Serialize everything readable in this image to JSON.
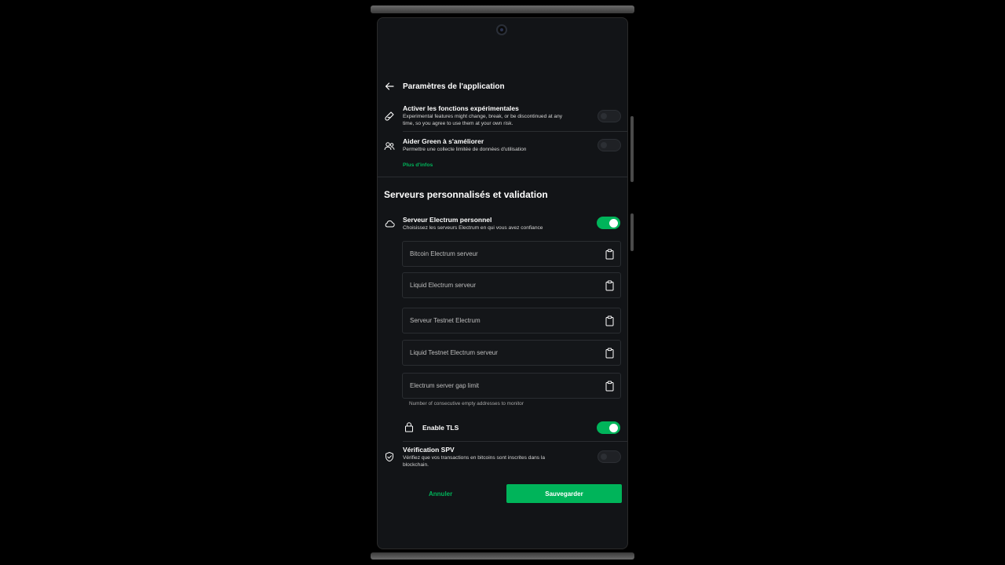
{
  "header": {
    "title": "Paramètres de l'application"
  },
  "experimental": {
    "title": "Activer les fonctions expérimentales",
    "desc_line1": "Experimental features might change, break, or be discontinued at any",
    "desc_line2": "time, so you agree to use them at your own risk.",
    "enabled": false
  },
  "analytics": {
    "title": "Aider Green à s'améliorer",
    "desc": "Permettre une collecte limitée de données d'utilisation",
    "link": "Plus d'infos",
    "enabled": false
  },
  "section_title": "Serveurs personnalisés et validation",
  "electrum": {
    "title": "Serveur Electrum personnel",
    "desc": "Choisissez les serveurs Electrum en qui vous avez confiance",
    "enabled": true,
    "fields": [
      {
        "placeholder": "Bitcoin Electrum serveur"
      },
      {
        "placeholder": "Liquid Electrum serveur"
      },
      {
        "placeholder": "Serveur Testnet Electrum"
      },
      {
        "placeholder": "Liquid Testnet Electrum serveur"
      },
      {
        "placeholder": "Electrum server gap limit"
      }
    ],
    "gap_hint": "Number of consecutive empty addresses to monitor"
  },
  "tls": {
    "label": "Enable TLS",
    "enabled": true
  },
  "spv": {
    "title": "Vérification SPV",
    "desc_line1": "Vérifiez que vos transactions en bitcoins sont inscrites dans la",
    "desc_line2": "blockchain.",
    "enabled": false
  },
  "actions": {
    "cancel": "Annuler",
    "save": "Sauvegarder"
  },
  "colors": {
    "accent": "#00b45a",
    "background": "#121417"
  }
}
